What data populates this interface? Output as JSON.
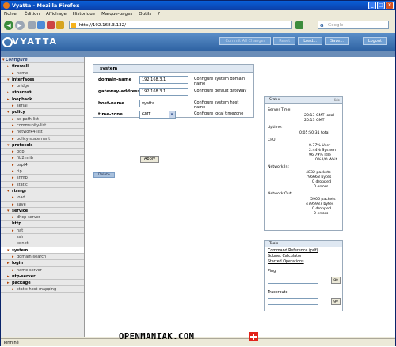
{
  "window": {
    "title": "Vyatta - Mozilla Firefox"
  },
  "menu": [
    "Fichier",
    "Édition",
    "Affichage",
    "Historique",
    "Marque-pages",
    "Outils",
    "?"
  ],
  "browser": {
    "url": "http://192.168.3.132/",
    "search_placeholder": "Google",
    "status": "Terminé"
  },
  "app": {
    "logo": "VYATTA",
    "buttons": [
      "Commit All Changes",
      "Reset",
      "Load...",
      "Save..."
    ],
    "logout": "Logout"
  },
  "sidebar": [
    {
      "label": "Configure",
      "level": 0,
      "arrow": "▾"
    },
    {
      "label": "firewall",
      "level": 1,
      "arrow": "▸"
    },
    {
      "label": "name",
      "level": 2,
      "arrow": "▸"
    },
    {
      "label": "interfaces",
      "level": 1,
      "arrow": "▾"
    },
    {
      "label": "bridge",
      "level": 2,
      "arrow": "▸"
    },
    {
      "label": "ethernet",
      "level": 1,
      "arrow": "▸"
    },
    {
      "label": "loopback",
      "level": 1,
      "arrow": "▸"
    },
    {
      "label": "serial",
      "level": 2,
      "arrow": "▸"
    },
    {
      "label": "policy",
      "level": 1,
      "arrow": "▾"
    },
    {
      "label": "as-path-list",
      "level": 2,
      "arrow": "▸"
    },
    {
      "label": "community-list",
      "level": 2,
      "arrow": "▸"
    },
    {
      "label": "network4-list",
      "level": 2,
      "arrow": "▸"
    },
    {
      "label": "policy-statement",
      "level": 2,
      "arrow": "▸"
    },
    {
      "label": "protocols",
      "level": 1,
      "arrow": "▾"
    },
    {
      "label": "bgp",
      "level": 2,
      "arrow": "▸"
    },
    {
      "label": "fib2mrib",
      "level": 2,
      "arrow": "▸"
    },
    {
      "label": "ospf4",
      "level": 2,
      "arrow": "▸"
    },
    {
      "label": "rip",
      "level": 2,
      "arrow": "▸"
    },
    {
      "label": "snmp",
      "level": 2,
      "arrow": "▸"
    },
    {
      "label": "static",
      "level": 2,
      "arrow": "▸"
    },
    {
      "label": "rtrmgr",
      "level": 1,
      "arrow": "▾"
    },
    {
      "label": "load",
      "level": 2,
      "arrow": "▸"
    },
    {
      "label": "save",
      "level": 2,
      "arrow": "▸"
    },
    {
      "label": "service",
      "level": 1,
      "arrow": "▾"
    },
    {
      "label": "dhcp-server",
      "level": 2,
      "arrow": "▸"
    },
    {
      "label": "http",
      "level": 1,
      "arrow": ""
    },
    {
      "label": "nat",
      "level": 2,
      "arrow": "▸"
    },
    {
      "label": "ssh",
      "level": 2,
      "arrow": ""
    },
    {
      "label": "telnet",
      "level": 2,
      "arrow": ""
    },
    {
      "label": "system",
      "level": 1,
      "arrow": "▾",
      "selected": true
    },
    {
      "label": "domain-search",
      "level": 2,
      "arrow": "▸"
    },
    {
      "label": "login",
      "level": 1,
      "arrow": "▸"
    },
    {
      "label": "name-server",
      "level": 2,
      "arrow": "▸"
    },
    {
      "label": "ntp-server",
      "level": 1,
      "arrow": "▸"
    },
    {
      "label": "package",
      "level": 1,
      "arrow": "▸"
    },
    {
      "label": "static-host-mapping",
      "level": 2,
      "arrow": "▸"
    }
  ],
  "form": {
    "title": "system",
    "domain_label": "domain-name",
    "domain_value": "192.168.3.1",
    "domain_help": "Configure system domain name",
    "gateway_label": "gateway-address",
    "gateway_value": "192.168.3.1",
    "gateway_help": "Configure default gateway",
    "host_label": "host-name",
    "host_value": "vyatta",
    "host_help": "Configure system host name",
    "tz_label": "time-zone",
    "tz_value": "GMT",
    "tz_help": "Configure local timezone",
    "apply": "Apply",
    "delete": "Delete"
  },
  "status": {
    "title": "Status",
    "hide": "Hide",
    "lines": [
      "Server Time:",
      "20:13 GMT local",
      "20:13 GMT",
      "Uptime:",
      "0:05:50:31 total",
      "CPU:",
      "0.77% User",
      "2.44% System",
      "96.79% Idle",
      "0% I/O Wait",
      "Network In:",
      "4832 packets",
      "796668 bytes",
      "0 dropped",
      "0 errors",
      "Network Out:",
      "5906 packets",
      "4795987 bytes",
      "0 dropped",
      "0 errors"
    ]
  },
  "tools": {
    "title": "Tools",
    "link1": "Command Reference (pdf)",
    "link2": "Subnet Calculator",
    "link3": "Started Operations",
    "ping": "Ping",
    "traceroute": "Traceroute",
    "go": "go"
  },
  "watermark": "OPENMANIAK.COM"
}
